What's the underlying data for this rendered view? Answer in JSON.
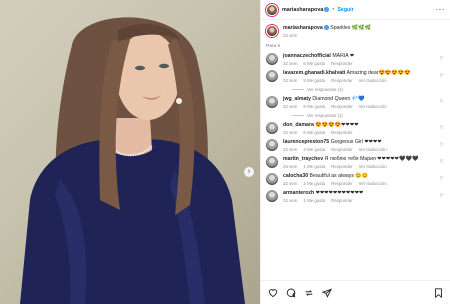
{
  "post": {
    "username": "mariasharapova",
    "follow_label": "Seguir",
    "more": "···",
    "caption_text": "Sparkles 🌿🌿🌿",
    "caption_time": "32 sem",
    "for_you_label": "Para ti"
  },
  "comments": [
    {
      "user": "joannaczechofficial",
      "text": "MARIA ❤",
      "time": "32 sem",
      "likes": "6 Me gusta",
      "reply": "Responder",
      "translate": "",
      "replies": ""
    },
    {
      "user": "lavazem.ghanadi.khalvati",
      "text": "Amazing dear😍😍😍😍😍",
      "time": "32 sem",
      "likes": "5 Me gusta",
      "reply": "Responder",
      "translate": "Ver traducción",
      "replies": "Ver respuestas (1)"
    },
    {
      "user": "jwg_almaty",
      "text": "Diamond Queen 💎💙",
      "time": "32 sem",
      "likes": "8 Me gusta",
      "reply": "Responder",
      "translate": "Ver traducción",
      "replies": "Ver respuestas (1)"
    },
    {
      "user": "don_damara",
      "text": "😍😍😍😍❤❤❤❤",
      "time": "32 sem",
      "likes": "6 Me gusta",
      "reply": "Responder",
      "translate": "",
      "replies": ""
    },
    {
      "user": "laurencepreston75",
      "text": "Gorgeous Girl ❤❤❤❤",
      "time": "32 sem",
      "likes": "3 Me gusta",
      "reply": "Responder",
      "translate": "Ver traducción",
      "replies": ""
    },
    {
      "user": "martin_traychev",
      "text": "Я люблю тебя Мария ❤❤❤❤❤🖤🖤🖤",
      "time": "25 sem",
      "likes": "1 Me gusta",
      "reply": "Responder",
      "translate": "Ver traducción",
      "replies": ""
    },
    {
      "user": "calocha30",
      "text": "Beautiful as always 😊😊",
      "time": "32 sem",
      "likes": "2 Me gusta",
      "reply": "Responder",
      "translate": "Ver traducción",
      "replies": ""
    },
    {
      "user": "armanterozh",
      "text": "❤❤❤❤❤❤❤❤❤❤❤",
      "time": "32 sem",
      "likes": "1 Me gusta",
      "reply": "Responder",
      "translate": "",
      "replies": ""
    }
  ],
  "colors": {
    "accent": "#0095f6",
    "verified": "#3897f0",
    "dress": "#1f2355"
  }
}
